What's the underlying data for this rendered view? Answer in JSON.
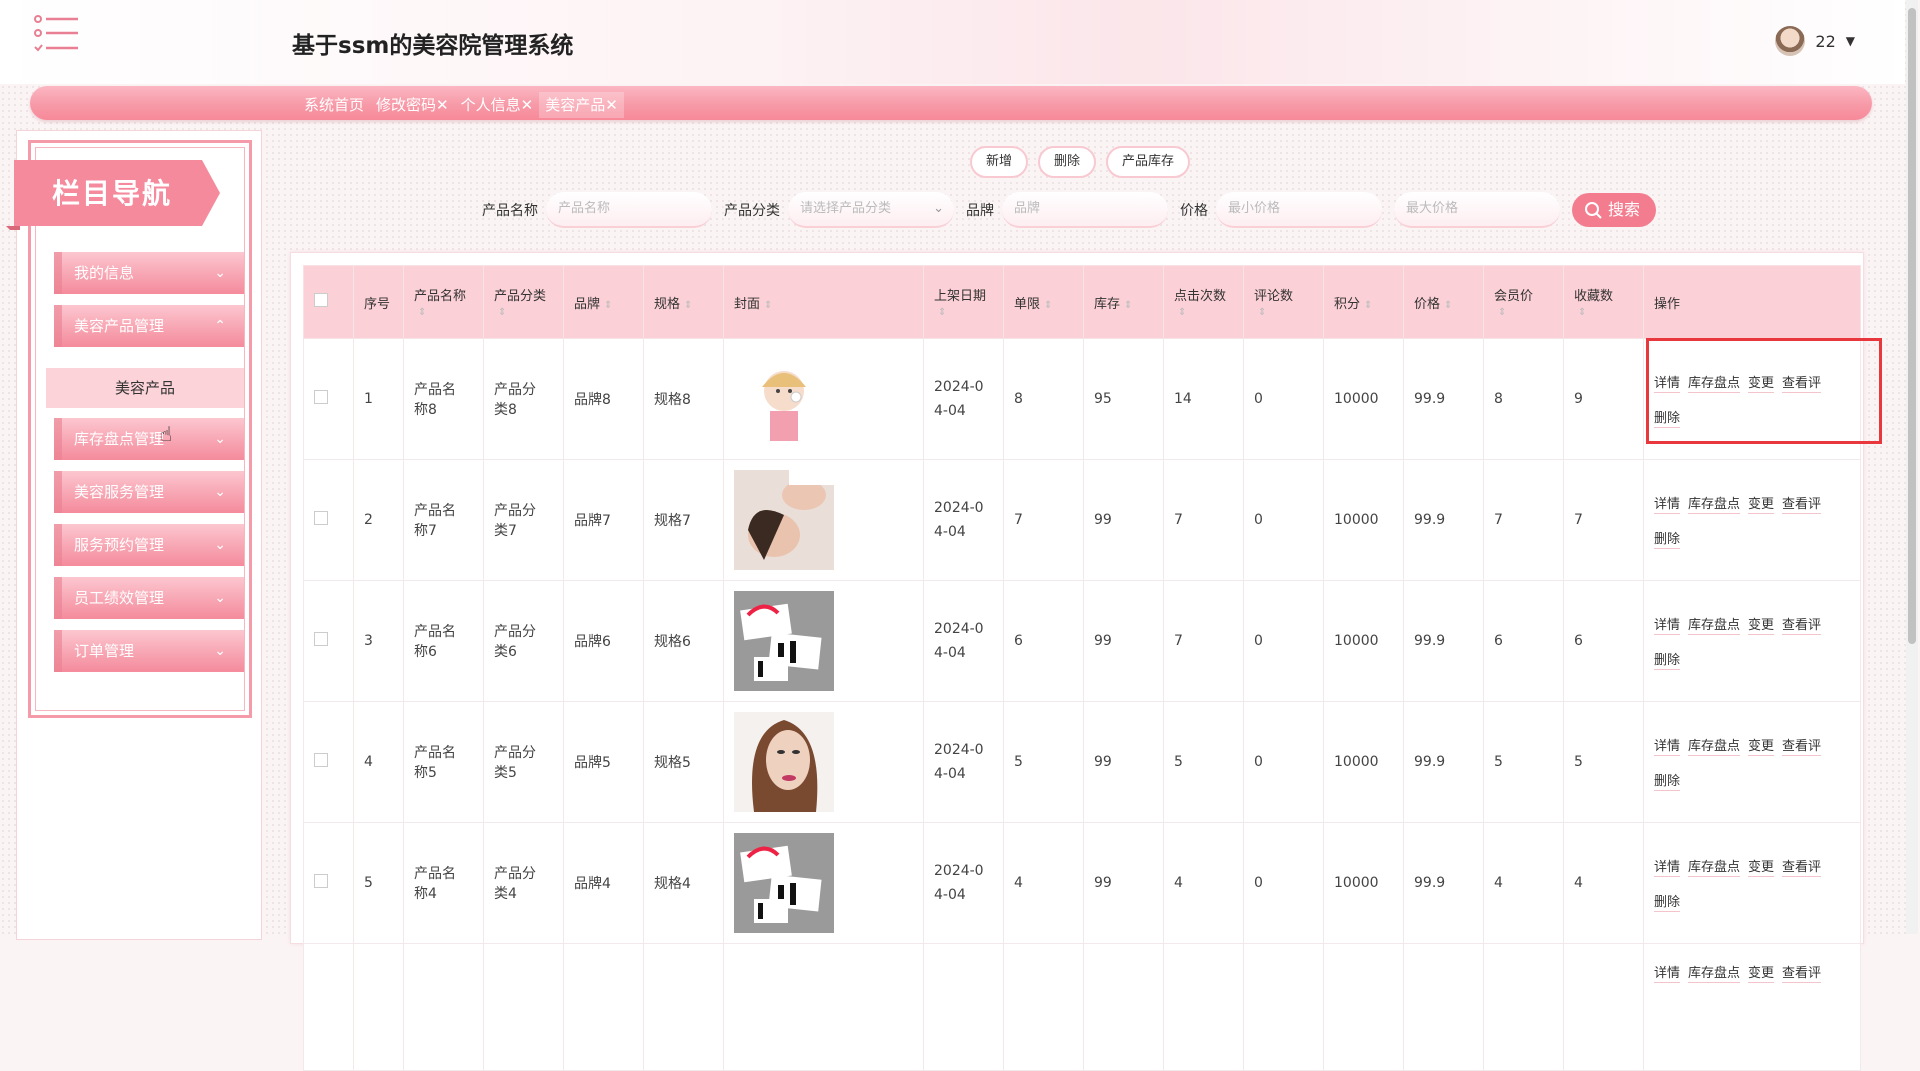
{
  "header": {
    "title": "基于ssm的美容院管理系统",
    "user": "22"
  },
  "tabs": [
    {
      "label": "系统首页",
      "closable": false
    },
    {
      "label": "修改密码",
      "closable": true
    },
    {
      "label": "个人信息",
      "closable": true
    },
    {
      "label": "美容产品",
      "closable": true
    }
  ],
  "sidebar": {
    "heading": "栏目导航",
    "items": [
      {
        "label": "我的信息",
        "chevron": "⌄"
      },
      {
        "label": "美容产品管理",
        "chevron": "⌃"
      },
      {
        "label": "库存盘点管理",
        "chevron": "⌄"
      },
      {
        "label": "美容服务管理",
        "chevron": "⌄"
      },
      {
        "label": "服务预约管理",
        "chevron": "⌄"
      },
      {
        "label": "员工绩效管理",
        "chevron": "⌄"
      },
      {
        "label": "订单管理",
        "chevron": "⌄"
      }
    ],
    "active_sub": "美容产品"
  },
  "actions": {
    "add": "新增",
    "delete": "删除",
    "inventory": "产品库存"
  },
  "search": {
    "name_label": "产品名称",
    "name_placeholder": "产品名称",
    "category_label": "产品分类",
    "category_placeholder": "请选择产品分类",
    "brand_label": "品牌",
    "brand_placeholder": "品牌",
    "price_label": "价格",
    "min_placeholder": "最小价格",
    "max_placeholder": "最大价格",
    "button": "搜索"
  },
  "table": {
    "headers": [
      "序号",
      "产品名称",
      "产品分类",
      "品牌",
      "规格",
      "封面",
      "上架日期",
      "单限",
      "库存",
      "点击次数",
      "评论数",
      "积分",
      "价格",
      "会员价",
      "收藏数",
      "操作"
    ],
    "ops": [
      "详情",
      "库存盘点",
      "变更",
      "查看评",
      "删除"
    ],
    "rows": [
      {
        "index": "1",
        "name": "产品名称8",
        "category": "产品分类8",
        "brand": "品牌8",
        "spec": "规格8",
        "image": "face-cream",
        "date": "2024-04-04",
        "limit": "8",
        "stock": "95",
        "clicks": "14",
        "comments": "0",
        "points": "10000",
        "price": "99.9",
        "member_price": "8",
        "favorites": "9"
      },
      {
        "index": "2",
        "name": "产品名称7",
        "category": "产品分类7",
        "brand": "品牌7",
        "spec": "规格7",
        "image": "facial-massage",
        "date": "2024-04-04",
        "limit": "7",
        "stock": "99",
        "clicks": "7",
        "comments": "0",
        "points": "10000",
        "price": "99.9",
        "member_price": "7",
        "favorites": "7"
      },
      {
        "index": "3",
        "name": "产品名称6",
        "category": "产品分类6",
        "brand": "品牌6",
        "spec": "规格6",
        "image": "business-cards",
        "date": "2024-04-04",
        "limit": "6",
        "stock": "99",
        "clicks": "7",
        "comments": "0",
        "points": "10000",
        "price": "99.9",
        "member_price": "6",
        "favorites": "6"
      },
      {
        "index": "4",
        "name": "产品名称5",
        "category": "产品分类5",
        "brand": "品牌5",
        "spec": "规格5",
        "image": "woman-portrait",
        "date": "2024-04-04",
        "limit": "5",
        "stock": "99",
        "clicks": "5",
        "comments": "0",
        "points": "10000",
        "price": "99.9",
        "member_price": "5",
        "favorites": "5"
      },
      {
        "index": "5",
        "name": "产品名称4",
        "category": "产品分类4",
        "brand": "品牌4",
        "spec": "规格4",
        "image": "business-cards",
        "date": "2024-04-04",
        "limit": "4",
        "stock": "99",
        "clicks": "4",
        "comments": "0",
        "points": "10000",
        "price": "99.9",
        "member_price": "4",
        "favorites": "4"
      }
    ],
    "partial_row_ops": [
      "详情",
      "库存盘点",
      "变更",
      "查看评"
    ]
  },
  "colors": {
    "accent": "#f37d8f",
    "header_row": "#fbd0d6",
    "highlight": "#e8383d"
  }
}
